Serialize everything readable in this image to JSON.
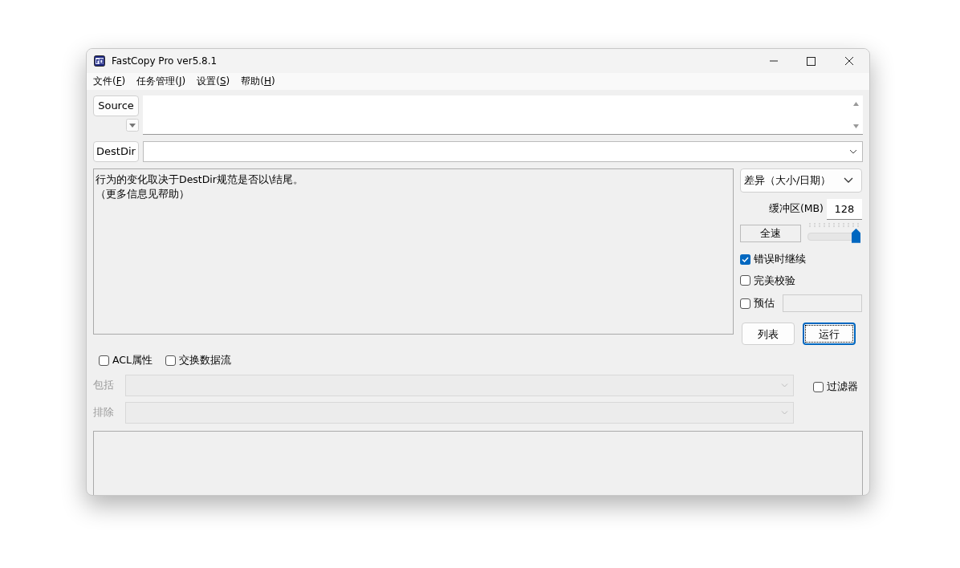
{
  "window": {
    "title": "FastCopy Pro ver5.8.1"
  },
  "menu": [
    {
      "label": "文件(F)"
    },
    {
      "label": "任务管理(J)"
    },
    {
      "label": "设置(S)"
    },
    {
      "label": "帮助(H)"
    }
  ],
  "source": {
    "button": "Source"
  },
  "destdir": {
    "button": "DestDir"
  },
  "message": [
    "行为的变化取决于DestDir规范是否以\\结尾。",
    "（更多信息见帮助）"
  ],
  "mode": {
    "value": "差异（大小/日期）"
  },
  "buffer": {
    "label": "缓冲区(MB)",
    "value": "128"
  },
  "speed": {
    "label": "全速",
    "level": 1.0
  },
  "options": [
    {
      "label": "错误时继续",
      "checked": true,
      "kind": "check"
    },
    {
      "label": "完美校验",
      "checked": false,
      "kind": "check"
    },
    {
      "label": "预估",
      "checked": false,
      "kind": "field"
    }
  ],
  "buttons": [
    {
      "label": "列表",
      "focused": false
    },
    {
      "label": "运行",
      "focused": true
    }
  ],
  "attributes": [
    {
      "label": "ACL属性",
      "checked": false
    },
    {
      "label": "交换数据流",
      "checked": false
    }
  ],
  "filters": [
    {
      "label": "包括",
      "disabled": true
    },
    {
      "label": "排除",
      "disabled": true
    }
  ],
  "filter_toggle": {
    "label": "过滤器",
    "checked": false
  }
}
